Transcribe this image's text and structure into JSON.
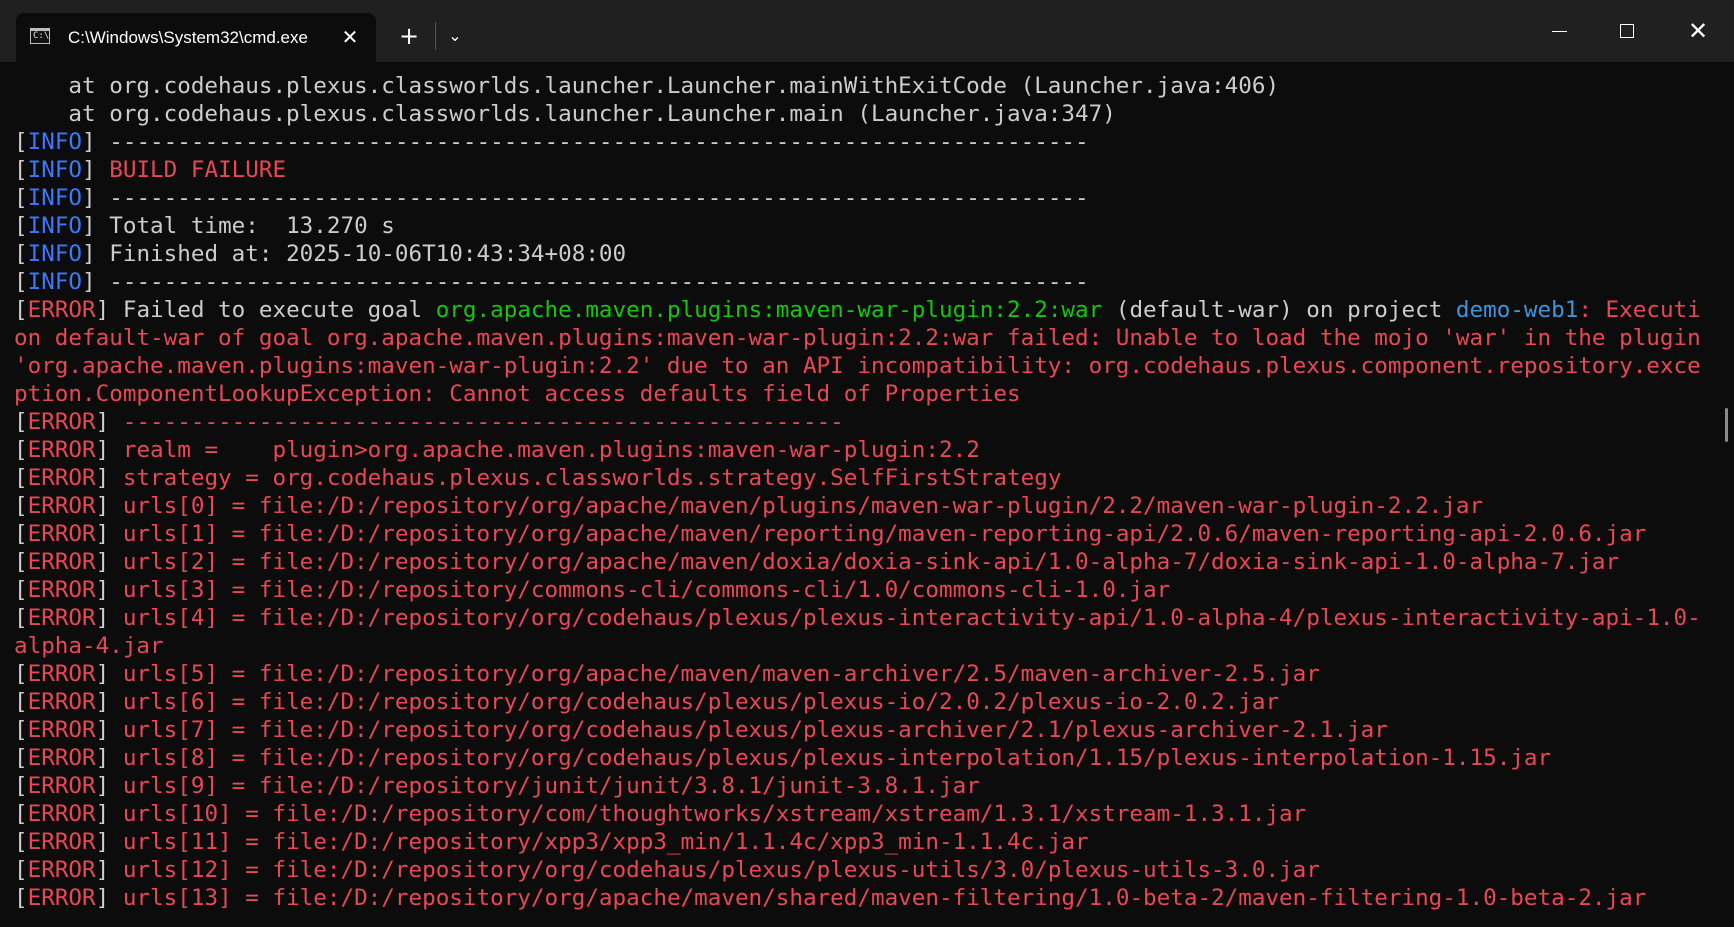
{
  "window": {
    "tab_title": "C:\\Windows\\System32\\cmd.exe",
    "tab_icon_text": "C:\\",
    "tab_close_glyph": "✕",
    "new_tab_glyph": "+",
    "dropdown_glyph": "⌄",
    "close_glyph": "✕"
  },
  "colors": {
    "background": "#0c0c0c",
    "titlebar": "#202020",
    "default_text": "#cccccc",
    "error_red": "#e74856",
    "info_blue": "#3b78ff",
    "goal_green": "#16c60c",
    "project_cyan": "#3a96dd"
  },
  "console": {
    "stack": [
      "    at org.codehaus.plexus.classworlds.launcher.Launcher.mainWithExitCode (Launcher.java:406)",
      "    at org.codehaus.plexus.classworlds.launcher.Launcher.main (Launcher.java:347)"
    ],
    "bracket_open": "[",
    "bracket_close": "]",
    "info_tag": "INFO",
    "error_tag": "ERROR",
    "info_lines": [
      " ------------------------------------------------------------------------",
      " BUILD FAILURE",
      " ------------------------------------------------------------------------",
      " Total time:  13.270 s",
      " Finished at: 2025-10-06T10:43:34+08:00",
      " ------------------------------------------------------------------------"
    ],
    "failed_prefix": " Failed to execute goal ",
    "goal": "org.apache.maven.plugins:maven-war-plugin:2.2:war",
    "goal_suffix": " (default-war) on project ",
    "project": "demo-web1",
    "failed_rest": ": Execution default-war of goal org.apache.maven.plugins:maven-war-plugin:2.2:war failed: Unable to load the mojo 'war' in the plugin 'org.apache.maven.plugins:maven-war-plugin:2.2' due to an API incompatibility: org.codehaus.plexus.component.repository.exception.ComponentLookupException: Cannot access defaults field of Properties",
    "error_lines": [
      " -----------------------------------------------------",
      " realm =    plugin>org.apache.maven.plugins:maven-war-plugin:2.2",
      " strategy = org.codehaus.plexus.classworlds.strategy.SelfFirstStrategy",
      " urls[0] = file:/D:/repository/org/apache/maven/plugins/maven-war-plugin/2.2/maven-war-plugin-2.2.jar",
      " urls[1] = file:/D:/repository/org/apache/maven/reporting/maven-reporting-api/2.0.6/maven-reporting-api-2.0.6.jar",
      " urls[2] = file:/D:/repository/org/apache/maven/doxia/doxia-sink-api/1.0-alpha-7/doxia-sink-api-1.0-alpha-7.jar",
      " urls[3] = file:/D:/repository/commons-cli/commons-cli/1.0/commons-cli-1.0.jar",
      " urls[4] = file:/D:/repository/org/codehaus/plexus/plexus-interactivity-api/1.0-alpha-4/plexus-interactivity-api-1.0-alpha-4.jar",
      " urls[5] = file:/D:/repository/org/apache/maven/maven-archiver/2.5/maven-archiver-2.5.jar",
      " urls[6] = file:/D:/repository/org/codehaus/plexus/plexus-io/2.0.2/plexus-io-2.0.2.jar",
      " urls[7] = file:/D:/repository/org/codehaus/plexus/plexus-archiver/2.1/plexus-archiver-2.1.jar",
      " urls[8] = file:/D:/repository/org/codehaus/plexus/plexus-interpolation/1.15/plexus-interpolation-1.15.jar",
      " urls[9] = file:/D:/repository/junit/junit/3.8.1/junit-3.8.1.jar",
      " urls[10] = file:/D:/repository/com/thoughtworks/xstream/xstream/1.3.1/xstream-1.3.1.jar",
      " urls[11] = file:/D:/repository/xpp3/xpp3_min/1.1.4c/xpp3_min-1.1.4c.jar",
      " urls[12] = file:/D:/repository/org/codehaus/plexus/plexus-utils/3.0/plexus-utils-3.0.jar",
      " urls[13] = file:/D:/repository/org/apache/maven/shared/maven-filtering/1.0-beta-2/maven-filtering-1.0-beta-2.jar"
    ]
  }
}
